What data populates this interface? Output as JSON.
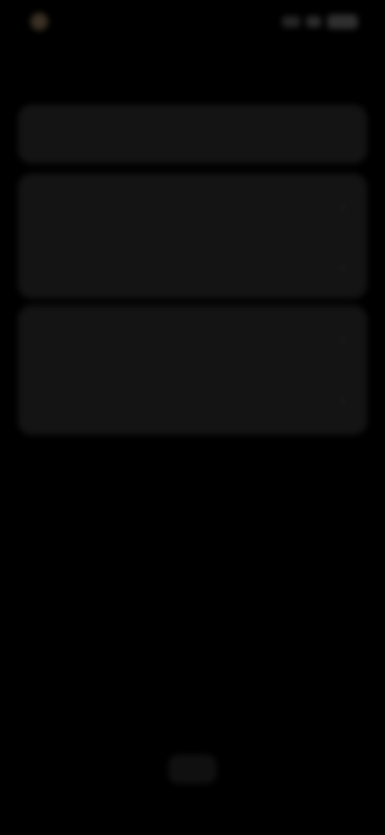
{
  "status_bar": {
    "time": "",
    "icons": [
      "signal-icon",
      "wifi-icon",
      "battery-icon"
    ]
  },
  "header": {
    "title": ""
  },
  "cards": [
    {
      "rows": [
        {
          "label": "",
          "value": ""
        }
      ]
    },
    {
      "rows": [
        {
          "label": ""
        },
        {
          "label": ""
        }
      ]
    },
    {
      "rows": [
        {
          "label": ""
        },
        {
          "label": ""
        }
      ]
    }
  ],
  "home_button": {
    "icon": "home-indicator"
  },
  "colors": {
    "background": "#000000",
    "card": "#1f1f1f",
    "accent_dot": "#5a4a38"
  }
}
